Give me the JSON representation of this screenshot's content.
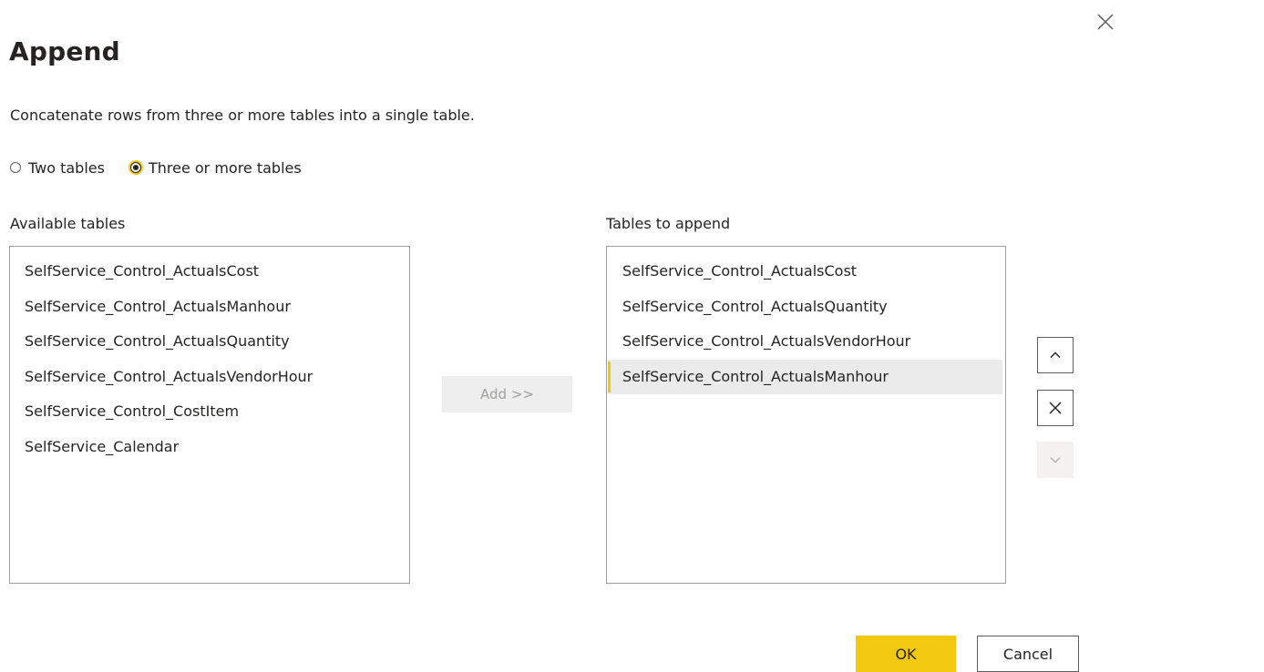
{
  "dialog": {
    "title": "Append",
    "description": "Concatenate rows from three or more tables into a single table."
  },
  "mode": {
    "options": [
      {
        "label": "Two tables",
        "checked": false
      },
      {
        "label": "Three or more tables",
        "checked": true
      }
    ]
  },
  "available": {
    "label": "Available tables",
    "items": [
      "SelfService_Control_ActualsCost",
      "SelfService_Control_ActualsManhour",
      "SelfService_Control_ActualsQuantity",
      "SelfService_Control_ActualsVendorHour",
      "SelfService_Control_CostItem",
      "SelfService_Calendar"
    ]
  },
  "add_button": {
    "label": "Add >>",
    "enabled": false
  },
  "to_append": {
    "label": "Tables to append",
    "items": [
      "SelfService_Control_ActualsCost",
      "SelfService_Control_ActualsQuantity",
      "SelfService_Control_ActualsVendorHour",
      "SelfService_Control_ActualsManhour"
    ],
    "selected_index": 3
  },
  "side_buttons": {
    "move_up_icon": "chevron-up-icon",
    "remove_icon": "close-icon",
    "move_down_icon": "chevron-down-icon"
  },
  "footer": {
    "ok_label": "OK",
    "cancel_label": "Cancel"
  },
  "colors": {
    "accent": "#f2c811",
    "selected_row": "#ebebeb",
    "disabled_bg": "#eeeeee"
  }
}
